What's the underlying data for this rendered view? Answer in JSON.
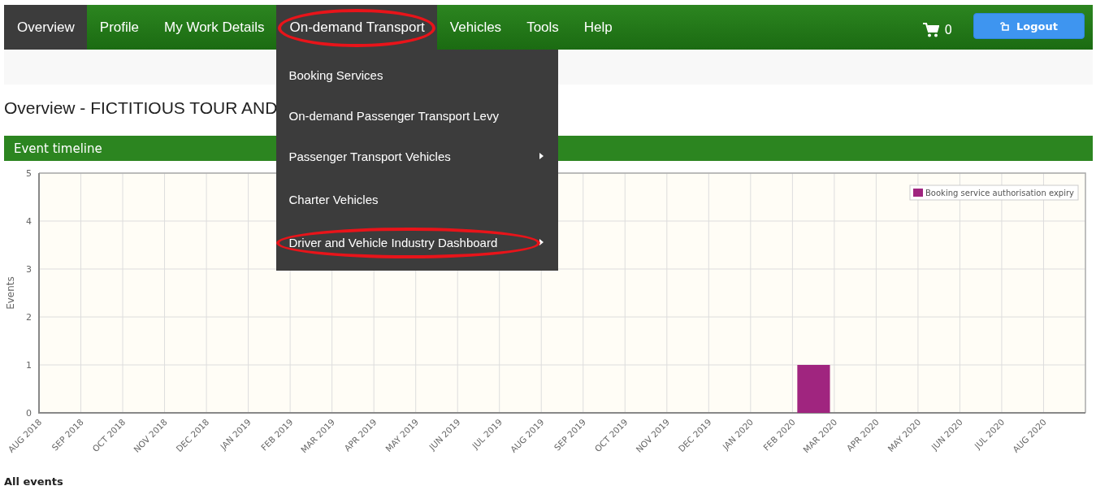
{
  "nav": {
    "items": [
      {
        "label": "Overview",
        "selected": true,
        "open": false,
        "circled": false
      },
      {
        "label": "Profile",
        "selected": false,
        "open": false,
        "circled": false
      },
      {
        "label": "My Work Details",
        "selected": false,
        "open": false,
        "circled": false
      },
      {
        "label": "On-demand Transport",
        "selected": false,
        "open": true,
        "circled": true
      },
      {
        "label": "Vehicles",
        "selected": false,
        "open": false,
        "circled": false
      },
      {
        "label": "Tools",
        "selected": false,
        "open": false,
        "circled": false
      },
      {
        "label": "Help",
        "selected": false,
        "open": false,
        "circled": false
      }
    ],
    "cart_count": "0",
    "logout": "Logout"
  },
  "dropdown": {
    "items": [
      {
        "label": "Booking Services",
        "submenu": false,
        "circled": false
      },
      {
        "label": "On-demand Passenger Transport Levy",
        "submenu": false,
        "circled": false
      },
      {
        "label": "Passenger Transport Vehicles",
        "submenu": true,
        "circled": false
      },
      {
        "label": "Charter Vehicles",
        "submenu": false,
        "circled": false
      },
      {
        "label": "Driver and Vehicle Industry Dashboard",
        "submenu": true,
        "circled": true
      }
    ]
  },
  "heading": "Overview - FICTITIOUS TOUR AND",
  "timeline": {
    "title": "Event timeline",
    "chart_data": {
      "type": "bar",
      "ylabel": "Events",
      "categories": [
        "AUG 2018",
        "SEP 2018",
        "OCT 2018",
        "NOV 2018",
        "DEC 2018",
        "JAN 2019",
        "FEB 2019",
        "MAR 2019",
        "APR 2019",
        "MAY 2019",
        "JUN 2019",
        "JUL 2019",
        "AUG 2019",
        "SEP 2019",
        "OCT 2019",
        "NOV 2019",
        "DEC 2019",
        "JAN 2020",
        "FEB 2020",
        "MAR 2020",
        "APR 2020",
        "MAY 2020",
        "JUN 2020",
        "JUL 2020",
        "AUG 2020"
      ],
      "series": [
        {
          "name": "Booking service authorisation expiry",
          "color": "#a0257f",
          "values": [
            0,
            0,
            0,
            0,
            0,
            0,
            0,
            0,
            0,
            0,
            0,
            0,
            0,
            0,
            0,
            0,
            0,
            0,
            1,
            0,
            0,
            0,
            0,
            0,
            0
          ]
        }
      ],
      "grid": true,
      "ylim": [
        0,
        5
      ],
      "yticks": [
        0,
        1,
        2,
        3,
        4,
        5
      ]
    }
  },
  "all_events": "All events"
}
